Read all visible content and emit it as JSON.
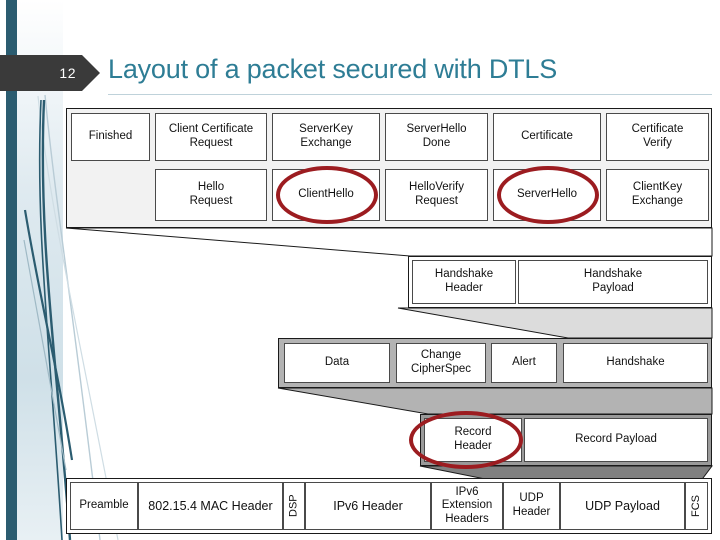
{
  "slide": {
    "number": "12",
    "title": "Layout of a packet secured with DTLS",
    "accent_color": "#2e7d95",
    "badge_color": "#3a3a3a",
    "highlight_color": "#9c1c20"
  },
  "diagram": {
    "name": "dtls-packet-layout",
    "rows": [
      {
        "id": "handshake-types-row-1",
        "cells": [
          {
            "label": "Finished"
          },
          {
            "label": "Client Certificate\nRequest"
          },
          {
            "label": "ServerKey\nExchange"
          },
          {
            "label": "ServerHello\nDone"
          },
          {
            "label": "Certificate"
          },
          {
            "label": "Certificate\nVerify"
          }
        ]
      },
      {
        "id": "handshake-types-row-2",
        "cells": [
          {
            "label": "Hello\nRequest",
            "highlighted": false
          },
          {
            "label": "ClientHello",
            "highlighted": true
          },
          {
            "label": "HelloVerify\nRequest",
            "highlighted": false
          },
          {
            "label": "ServerHello",
            "highlighted": true
          },
          {
            "label": "ClientKey\nExchange",
            "highlighted": false
          }
        ]
      },
      {
        "id": "handshake-message",
        "cells": [
          {
            "label": "Handshake\nHeader"
          },
          {
            "label": "Handshake\nPayload"
          }
        ]
      },
      {
        "id": "record-content-types",
        "cells": [
          {
            "label": "Data"
          },
          {
            "label": "Change\nCipherSpec"
          },
          {
            "label": "Alert"
          },
          {
            "label": "Handshake"
          }
        ]
      },
      {
        "id": "dtls-record",
        "cells": [
          {
            "label": "Record\nHeader",
            "highlighted": true
          },
          {
            "label": "Record Payload",
            "highlighted": false
          }
        ]
      },
      {
        "id": "link-layer-frame",
        "cells": [
          {
            "label": "Preamble"
          },
          {
            "label": "802.15.4 MAC Header"
          },
          {
            "label": "DSP",
            "vertical": true
          },
          {
            "label": "IPv6 Header"
          },
          {
            "label": "IPv6\nExtension\nHeaders"
          },
          {
            "label": "UDP\nHeader"
          },
          {
            "label": "UDP Payload"
          },
          {
            "label": "FCS",
            "vertical": true
          }
        ]
      }
    ]
  }
}
